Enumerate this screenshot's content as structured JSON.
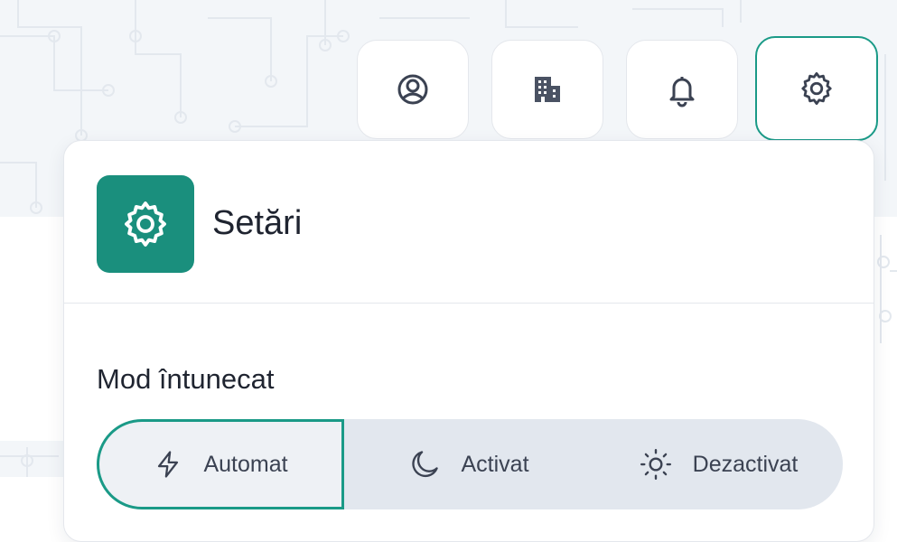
{
  "topbar": {
    "buttons": [
      {
        "icon": "user-circle-icon"
      },
      {
        "icon": "building-icon"
      },
      {
        "icon": "bell-icon"
      },
      {
        "icon": "gear-icon",
        "active": true
      }
    ]
  },
  "settings_panel": {
    "title": "Setări",
    "icon": "gear-icon",
    "dark_mode": {
      "label": "Mod întunecat",
      "options": [
        {
          "label": "Automat",
          "icon": "lightning-icon",
          "selected": true
        },
        {
          "label": "Activat",
          "icon": "moon-icon",
          "selected": false
        },
        {
          "label": "Dezactivat",
          "icon": "sun-icon",
          "selected": false
        }
      ]
    }
  },
  "colors": {
    "accent": "#1a9a87",
    "icon_box": "#1a8f7d",
    "segment_bg": "#e2e7ee"
  }
}
